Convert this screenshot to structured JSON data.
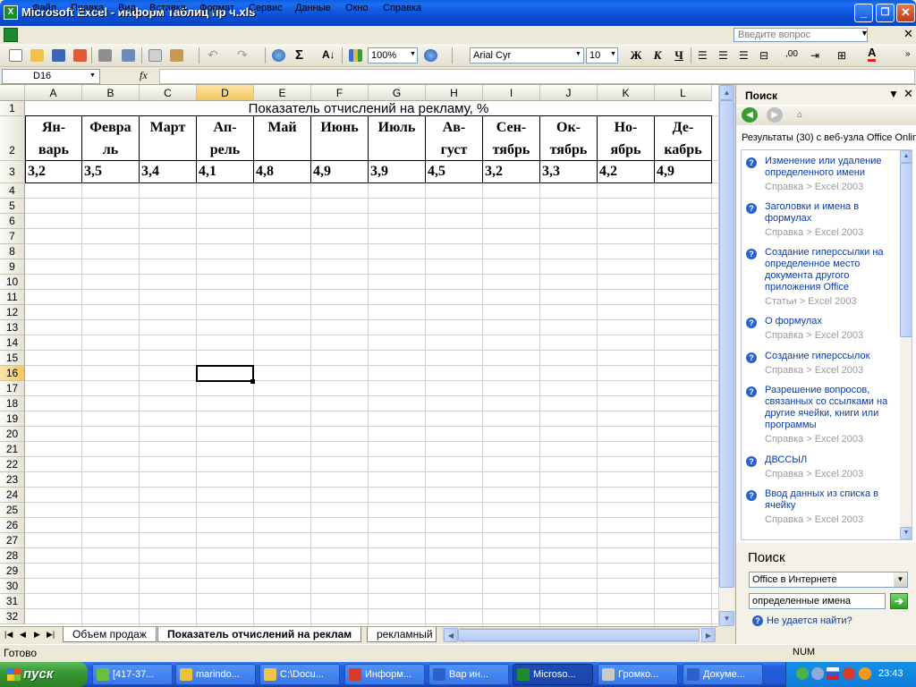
{
  "window": {
    "title": "Microsoft Excel - информ таблиц пр ч.xls",
    "min": "_",
    "max": "❐",
    "close": "✕"
  },
  "menu": {
    "items": [
      "Файл",
      "Правка",
      "Вид",
      "Вставка",
      "Формат",
      "Сервис",
      "Данные",
      "Окно",
      "Справка"
    ],
    "help_placeholder": "Введите вопрос"
  },
  "toolbar": {
    "zoom": "100%",
    "font": "Arial Cyr",
    "size": "10",
    "bold": "Ж",
    "italic": "К",
    "underline": "Ч",
    "sigma": "Σ"
  },
  "formula": {
    "cell_ref": "D16",
    "fx": "fx",
    "value": ""
  },
  "sheet": {
    "columns": [
      "A",
      "B",
      "C",
      "D",
      "E",
      "F",
      "G",
      "H",
      "I",
      "J",
      "K",
      "L"
    ],
    "rows": [
      "1",
      "2",
      "3",
      "4",
      "5",
      "6",
      "7",
      "8",
      "9",
      "10",
      "11",
      "12",
      "13",
      "14",
      "15",
      "16",
      "17",
      "18",
      "19",
      "20",
      "21",
      "22",
      "23",
      "24",
      "25",
      "26",
      "27",
      "28",
      "29",
      "30",
      "31",
      "32"
    ],
    "title_text": "Показатель отчислений на рекламу, %",
    "months": [
      [
        "Ян-",
        "варь"
      ],
      [
        "Февра",
        "ль"
      ],
      [
        "Март",
        ""
      ],
      [
        "Ап-",
        "рель"
      ],
      [
        "Май",
        ""
      ],
      [
        "Июнь",
        ""
      ],
      [
        "Июль",
        ""
      ],
      [
        "Ав-",
        "густ"
      ],
      [
        "Сен-",
        "тябрь"
      ],
      [
        "Ок-",
        "тябрь"
      ],
      [
        "Но-",
        "ябрь"
      ],
      [
        "Де-",
        "кабрь"
      ]
    ],
    "values": [
      "3,2",
      "3,5",
      "3,4",
      "4,1",
      "4,8",
      "4,9",
      "3,9",
      "4,5",
      "3,2",
      "3,3",
      "4,2",
      "4,9"
    ],
    "active_col": "D",
    "active_row": "16"
  },
  "tabs": [
    {
      "label": "Объем продаж",
      "active": false
    },
    {
      "label": "Показатель отчислений на реклам",
      "active": true
    },
    {
      "label": "рекламный",
      "active": false
    }
  ],
  "status": {
    "text": "Готово",
    "num": "NUM"
  },
  "task_pane": {
    "title": "Поиск",
    "results_header": "Результаты (30) с веб-узла Office Online",
    "results": [
      {
        "title": "Изменение или удаление определенного имени",
        "source": "Справка > Excel 2003"
      },
      {
        "title": "Заголовки и имена в формулах",
        "source": "Справка > Excel 2003"
      },
      {
        "title": "Создание гиперссылки на определенное место документа другого приложения Office",
        "source": "Статьи > Excel 2003"
      },
      {
        "title": "О формулах",
        "source": "Справка > Excel 2003"
      },
      {
        "title": "Создание гиперссылок",
        "source": "Справка > Excel 2003"
      },
      {
        "title": "Разрешение вопросов, связанных со ссылками на другие ячейки, книги или программы",
        "source": "Справка > Excel 2003"
      },
      {
        "title": "ДВССЫЛ",
        "source": "Справка > Excel 2003"
      },
      {
        "title": "Ввод данных из списка в ячейку",
        "source": "Справка > Excel 2003"
      }
    ],
    "search_label": "Поиск",
    "scope": "Office в Интернете",
    "query": "определенные имена",
    "cant_find": "Не удается найти?"
  },
  "taskbar": {
    "start": "пуск",
    "tasks": [
      {
        "label": "[417-37...",
        "color": "#6cbf3c"
      },
      {
        "label": "marindo...",
        "color": "#e9c23a"
      },
      {
        "label": "C:\\Docu...",
        "color": "#f0c24a"
      },
      {
        "label": "Информ...",
        "color": "#d63c2b"
      },
      {
        "label": "Вар ин...",
        "color": "#2f5fcc"
      },
      {
        "label": "Microso...",
        "color": "#1e8a2e"
      },
      {
        "label": "Громко...",
        "color": "#c9c9c9"
      },
      {
        "label": "Докуме...",
        "color": "#2f5fcc"
      }
    ],
    "clock": "23:43"
  }
}
